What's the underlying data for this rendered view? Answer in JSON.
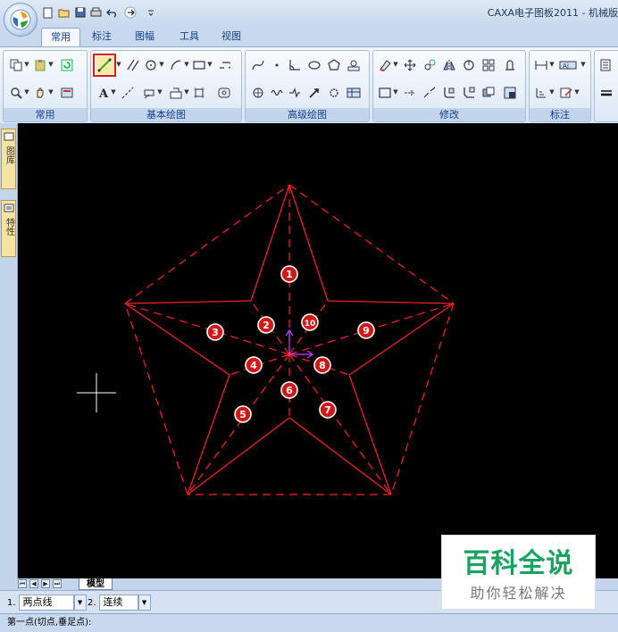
{
  "window": {
    "title": "CAXA电子图板2011 - 机械版"
  },
  "ribbon": {
    "tabs": [
      {
        "label": "常用",
        "active": true
      },
      {
        "label": "标注"
      },
      {
        "label": "图幅"
      },
      {
        "label": "工具"
      },
      {
        "label": "视图"
      }
    ],
    "groups": [
      "常用",
      "基本绘图",
      "高级绘图",
      "修改",
      "标注"
    ],
    "highlighted_tool": "line-tool"
  },
  "sidepanel": {
    "tabs": [
      "图库",
      "特性"
    ]
  },
  "drawing": {
    "line_color": "#ff2020",
    "marker_color": "#d01818",
    "markers": [
      "1",
      "2",
      "3",
      "4",
      "5",
      "6",
      "7",
      "8",
      "9",
      "10"
    ]
  },
  "sheet_tabs": {
    "model": "模型"
  },
  "command_options": [
    {
      "num": "1.",
      "value": "两点线"
    },
    {
      "num": "2.",
      "value": "连续"
    }
  ],
  "status": {
    "prompt": "第一点(切点,垂足点):"
  },
  "watermark": {
    "title": "百科全说",
    "subtitle": "助你轻松解决"
  }
}
